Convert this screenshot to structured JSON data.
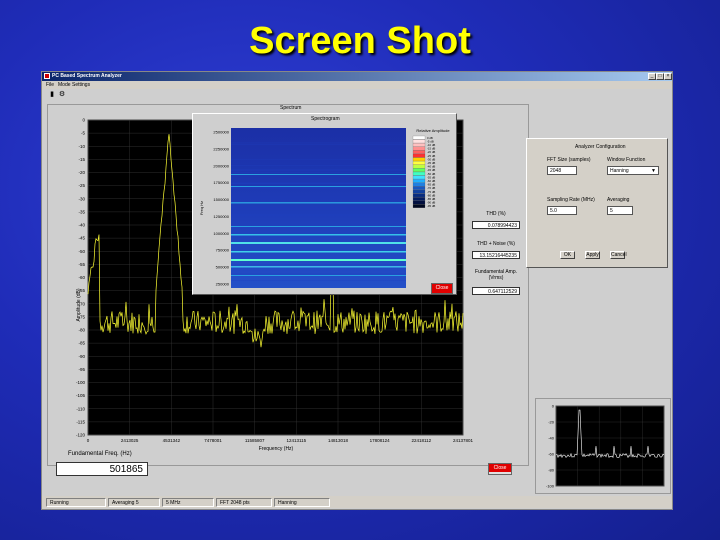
{
  "slide_title": "Screen Shot",
  "window": {
    "title": "PC Based Spectrum Analyzer",
    "min": "_",
    "max": "□",
    "close": "×"
  },
  "menu": [
    "File",
    "Mode",
    "Settings"
  ],
  "spectrum": {
    "panel_title": "Spectrum",
    "y_axis_label": "Amplitude (dB)",
    "x_axis_label": "Frequency (Hz)",
    "y_ticks": [
      "0",
      "-5",
      "-10",
      "-15",
      "-20",
      "-25",
      "-30",
      "-35",
      "-40",
      "-45",
      "-50",
      "-55",
      "-60",
      "-65",
      "-70",
      "-75",
      "-80",
      "-85",
      "-90",
      "-95",
      "-100",
      "-105",
      "-110",
      "-115",
      "-120"
    ],
    "x_ticks": [
      "0",
      "2413025",
      "4531342",
      "7478001",
      "11585807",
      "12413115",
      "14813018",
      "17808124",
      "22418112",
      "24137801"
    ],
    "fundamental_label": "Fundamental Freq. (Hz)",
    "fundamental_value": "501865",
    "close_label": "Close"
  },
  "thd": {
    "thd_label": "THD (%)",
    "thd_value": "0.078994423",
    "thdn_label": "THD + Noise (%)",
    "thdn_value": "13.15216445235",
    "fund_amp_label": "Fundamental Amp. (Vrms)",
    "fund_amp_value": "0.647112529"
  },
  "spectrogram": {
    "title": "Spectrogram",
    "y_label": "Freq Hz",
    "y_ticks": [
      "2500000",
      "2250000",
      "2000000",
      "1750000",
      "1500000",
      "1250000",
      "1000000",
      "750000",
      "500000",
      "250000"
    ],
    "legend_title": "Relative Amplitude",
    "legend_labels": [
      "0 dB",
      "-5 dB",
      "-10 dB",
      "-15 dB",
      "-20 dB",
      "-25 dB",
      "-30 dB",
      "-35 dB",
      "-40 dB",
      "-45 dB",
      "-50 dB",
      "-55 dB",
      "-60 dB",
      "-65 dB",
      "-70 dB",
      "-75 dB",
      "-80 dB",
      "-85 dB",
      "-90 dB",
      "-95 dB"
    ],
    "legend_colors": [
      "#ffffff",
      "#ffe0e0",
      "#ffc0c0",
      "#ff9090",
      "#ff6060",
      "#ff3030",
      "#ffd000",
      "#ffff40",
      "#c0ff40",
      "#60ff60",
      "#40ffc0",
      "#40e0ff",
      "#20b0ff",
      "#2080e0",
      "#1858c0",
      "#1040a0",
      "#082c80",
      "#041c60",
      "#021040",
      "#000820"
    ],
    "close_label": "Close"
  },
  "config": {
    "title": "Analyzer Configuration",
    "fft_label": "FFT Size (samples)",
    "fft_value": "2048",
    "window_label": "Window Function",
    "window_value": "Hanning",
    "sr_label": "Sampling Rate (MHz)",
    "sr_value": "5.0",
    "avg_label": "Averaging",
    "avg_value": "5",
    "ok": "OK",
    "apply": "Apply",
    "cancel": "Cancel"
  },
  "mini": {
    "y_ticks": [
      "0",
      "-20",
      "-40",
      "-60",
      "-80",
      "-100"
    ]
  },
  "status": [
    "Running",
    "Averaging 5",
    "5 MHz",
    "FFT 2048 pts",
    "Hanning"
  ],
  "colors": {
    "background": "#1f2cb8",
    "title": "#ffff00",
    "trace": "#ffff33",
    "plot_bg": "#000000",
    "accent_red": "#e00000"
  }
}
